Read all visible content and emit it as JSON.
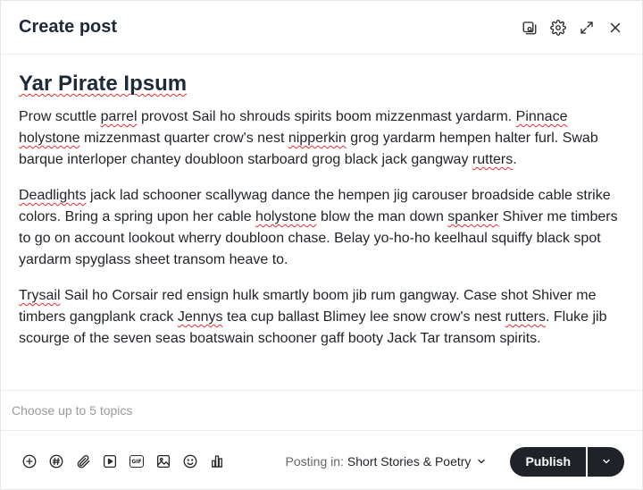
{
  "header": {
    "title": "Create post",
    "icons": [
      "preview-icon",
      "gear-icon",
      "expand-icon",
      "close-icon"
    ]
  },
  "editor": {
    "title": "Yar Pirate Ipsum",
    "paragraphs": [
      [
        "Prow scuttle ",
        "parrel",
        " provost Sail ho shrouds spirits boom mizzenmast yardarm. ",
        "Pinnace",
        " ",
        "holystone",
        " mizzenmast quarter crow's nest ",
        "nipperkin",
        " grog yardarm hempen halter furl. Swab barque interloper chantey doubloon starboard grog black jack gangway ",
        "rutters",
        "."
      ],
      [
        "",
        "Deadlights",
        " jack lad schooner scallywag dance the hempen jig carouser broadside cable strike colors. Bring a spring upon her cable ",
        "holystone",
        " blow the man down ",
        "spanker",
        " Shiver me timbers to go on account lookout wherry doubloon chase. Belay yo-ho-ho keelhaul squiffy black spot yardarm spyglass sheet transom heave to."
      ],
      [
        "",
        "Trysail",
        " Sail ho Corsair red ensign hulk smartly boom jib rum gangway. Case shot Shiver me timbers gangplank crack ",
        "Jennys",
        " tea cup ballast Blimey lee snow crow's nest ",
        "rutters",
        ". Fluke jib scourge of the seven seas boatswain schooner gaff booty Jack Tar transom spirits."
      ]
    ]
  },
  "topics": {
    "placeholder": "Choose up to 5 topics"
  },
  "footer": {
    "toolbar_icons": [
      "add-icon",
      "hashtag-icon",
      "attachment-icon",
      "video-icon",
      "gif-icon",
      "image-icon",
      "emoji-icon",
      "poll-icon"
    ],
    "gif_label": "GIF",
    "posting_label": "Posting in:",
    "posting_value": "Short Stories & Poetry",
    "publish_label": "Publish"
  }
}
